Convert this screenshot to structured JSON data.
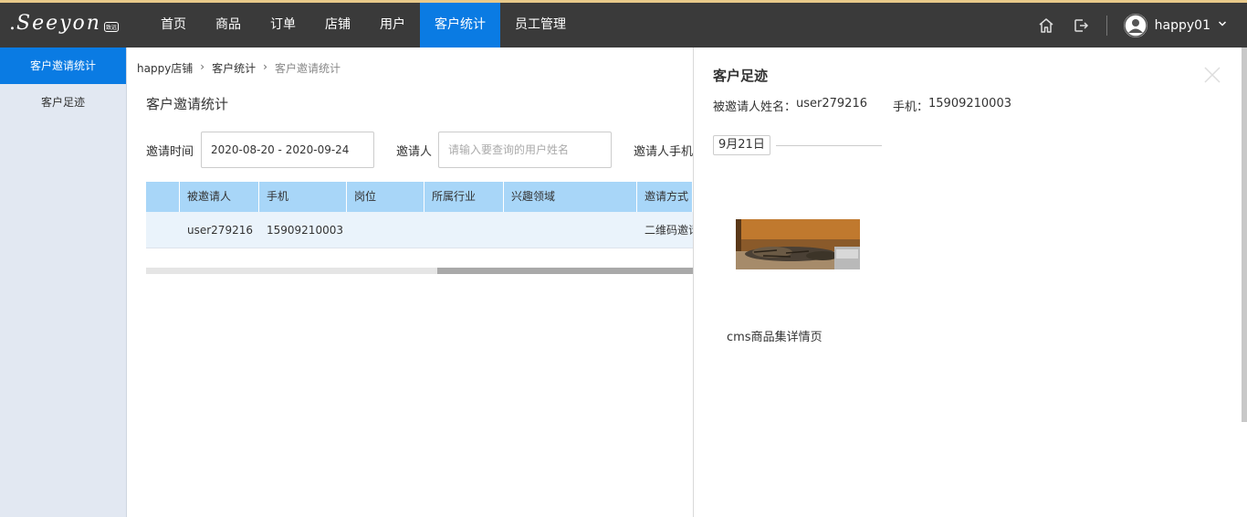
{
  "header": {
    "logo_text": "Seeyon",
    "logo_sub": "致远",
    "nav": [
      "首页",
      "商品",
      "订单",
      "店铺",
      "用户",
      "客户统计",
      "员工管理"
    ],
    "active_nav": "客户统计",
    "user_name": "happy01"
  },
  "sidebar": {
    "items": [
      {
        "label": "客户邀请统计",
        "active": true
      },
      {
        "label": "客户足迹",
        "active": false
      }
    ]
  },
  "breadcrumb": [
    "happy店铺",
    "客户统计",
    "客户邀请统计"
  ],
  "page_title": "客户邀请统计",
  "filters": {
    "invite_time_label": "邀请时间",
    "invite_time_value": "2020-08-20 - 2020-09-24",
    "inviter_label": "邀请人",
    "inviter_placeholder": "请输入要查询的用户姓名",
    "inviter_phone_label": "邀请人手机"
  },
  "table": {
    "columns": [
      "被邀请人",
      "手机",
      "岗位",
      "所属行业",
      "兴趣领域",
      "邀请方式"
    ],
    "rows": [
      [
        "user279216",
        "15909210003",
        "",
        "",
        "",
        "二维码邀请"
      ]
    ]
  },
  "panel": {
    "title": "客户足迹",
    "invitee_label": "被邀请人姓名：",
    "invitee_name": "user279216",
    "phone_label": "手机：",
    "phone": "15909210003",
    "date_tag": "9月21日",
    "caption": "cms商品集详情页"
  },
  "colors": {
    "topbar": "#3a3a3a",
    "accent": "#0a7be3",
    "table_header": "#a8d6f8",
    "sidebar": "#e2e8f2"
  }
}
